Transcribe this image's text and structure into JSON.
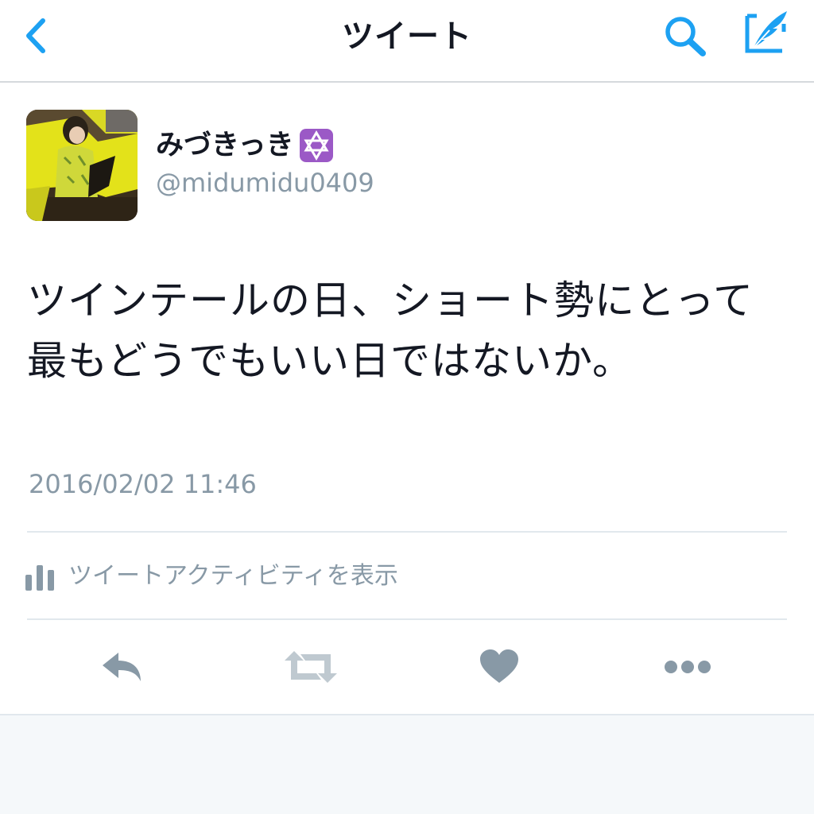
{
  "nav": {
    "title": "ツイート",
    "back_icon": "chevron-left-icon",
    "search_icon": "search-icon",
    "compose_icon": "compose-tweet-icon"
  },
  "tweet": {
    "display_name": "みづきっき",
    "name_badge_icon": "star-of-david-icon",
    "username": "@midumidu0409",
    "text": "ツインテールの日、ショート勢にとって最もどうでもいい日ではないか。",
    "timestamp": "2016/02/02 11:46",
    "activity_label": "ツイートアクティビティを表示"
  },
  "actions": {
    "reply_icon": "reply-icon",
    "retweet_icon": "retweet-icon",
    "like_icon": "heart-icon",
    "more_icon": "more-icon"
  },
  "colors": {
    "accent": "#1da1f2",
    "text": "#141823",
    "secondary": "#8899a6",
    "action_gray": "#8899a6",
    "divider": "#e1e8ed",
    "badge_purple": "#9b59c6"
  }
}
